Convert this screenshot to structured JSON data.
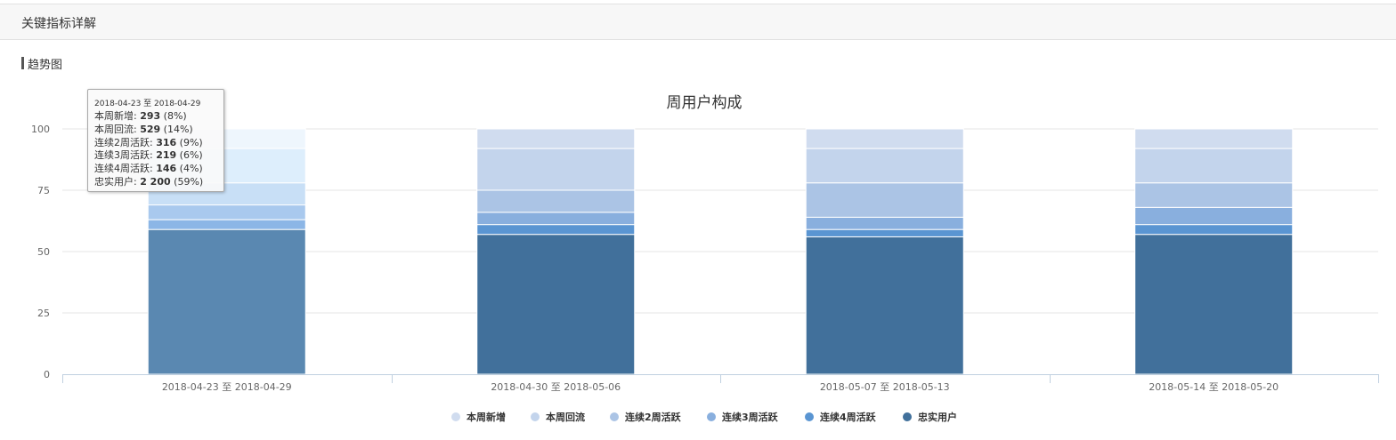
{
  "header": {
    "title": "关键指标详解"
  },
  "section": {
    "title": "趋势图"
  },
  "chart_data": {
    "type": "bar",
    "stacked": true,
    "percent": true,
    "title": "周用户构成",
    "categories": [
      "2018-04-23 至 2018-04-29",
      "2018-04-30 至 2018-05-06",
      "2018-05-07 至 2018-05-13",
      "2018-05-14 至 2018-05-20"
    ],
    "ylim": [
      0,
      100
    ],
    "yticks": [
      0,
      25,
      50,
      75,
      100
    ],
    "grid": true,
    "legend": "bottom-center",
    "series": [
      {
        "name": "本周新增",
        "color": "#d0dcef",
        "values": [
          8,
          8,
          8,
          8
        ]
      },
      {
        "name": "本周回流",
        "color": "#c3d4ec",
        "values": [
          14,
          17,
          14,
          14
        ]
      },
      {
        "name": "连续2周活跃",
        "color": "#abc4e5",
        "values": [
          9,
          9,
          14,
          10
        ]
      },
      {
        "name": "连续3周活跃",
        "color": "#89afde",
        "values": [
          6,
          5,
          5,
          7
        ]
      },
      {
        "name": "连续4周活跃",
        "color": "#5a95d2",
        "values": [
          4,
          4,
          3,
          4
        ]
      },
      {
        "name": "忠实用户",
        "color": "#41709b",
        "values": [
          59,
          57,
          56,
          57
        ]
      }
    ],
    "highlight_index": 0,
    "highlight_colors": [
      "#eef6fd",
      "#ddeefc",
      "#c8dff6",
      "#a9c9ee",
      "#8cb6e6",
      "#5a88b1"
    ]
  },
  "tooltip": {
    "header": "2018-04-23 至 2018-04-29",
    "rows": [
      {
        "label": "本周新增: ",
        "value": "293",
        "pct": "(8%)"
      },
      {
        "label": "本周回流: ",
        "value": "529",
        "pct": "(14%)"
      },
      {
        "label": "连续2周活跃: ",
        "value": "316",
        "pct": "(9%)"
      },
      {
        "label": "连续3周活跃: ",
        "value": "219",
        "pct": "(6%)"
      },
      {
        "label": "连续4周活跃: ",
        "value": "146",
        "pct": "(4%)"
      },
      {
        "label": "忠实用户: ",
        "value": "2 200",
        "pct": "(59%)"
      }
    ]
  }
}
